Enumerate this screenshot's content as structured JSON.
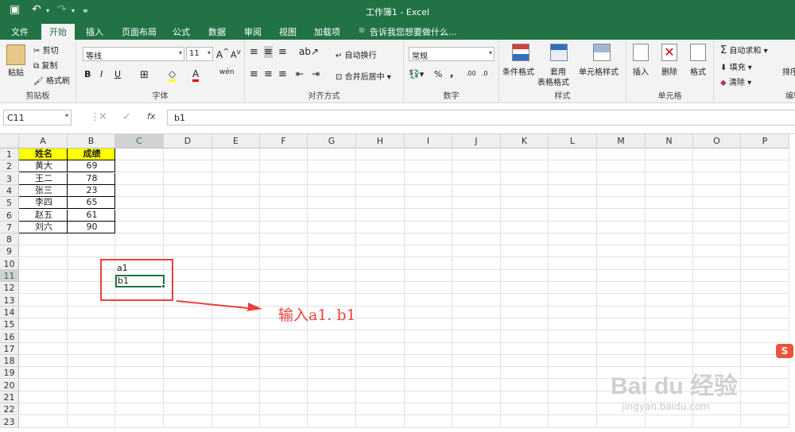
{
  "titlebar": {
    "title": "工作簿1 - Excel",
    "qa_save": "💾",
    "qa_undo": "↶",
    "qa_redo": "↷"
  },
  "tabs": [
    "文件",
    "开始",
    "插入",
    "页面布局",
    "公式",
    "数据",
    "审阅",
    "视图",
    "加载项"
  ],
  "tellme": "告诉我您想要做什么...",
  "ribbon": {
    "clipboard": {
      "paste": "粘贴",
      "cut": "剪切",
      "copy": "复制",
      "format_painter": "格式刷",
      "label": "剪贴板"
    },
    "font": {
      "name": "等线",
      "size": "11",
      "bold": "B",
      "italic": "I",
      "underline": "U",
      "label": "字体"
    },
    "align": {
      "wrap": "自动换行",
      "merge": "合并后居中",
      "label": "对齐方式"
    },
    "number": {
      "format": "常规",
      "percent": "%",
      "comma": ",",
      "label": "数字"
    },
    "styles": {
      "cond": "条件格式",
      "table": "套用",
      "table2": "表格格式",
      "cell": "单元格样式",
      "label": "样式"
    },
    "cells": {
      "insert": "插入",
      "delete": "删除",
      "format": "格式",
      "label": "单元格"
    },
    "edit": {
      "autosum": "自动求和",
      "fill": "填充",
      "clear": "清除",
      "sort": "排序",
      "label": "编辑"
    }
  },
  "formula": {
    "namebox": "C11",
    "fx": "fx",
    "value": "b1"
  },
  "columns": [
    "A",
    "B",
    "C",
    "D",
    "E",
    "F",
    "G",
    "H",
    "I",
    "J",
    "K",
    "L",
    "M",
    "N",
    "O",
    "P"
  ],
  "rows": [
    "1",
    "2",
    "3",
    "4",
    "5",
    "6",
    "7",
    "8",
    "9",
    "10",
    "11",
    "12",
    "13",
    "14",
    "15",
    "16",
    "17",
    "18",
    "19",
    "20",
    "21",
    "22",
    "23"
  ],
  "table": {
    "headers": [
      "姓名",
      "成绩"
    ],
    "data": [
      [
        "黄大",
        "69"
      ],
      [
        "王二",
        "78"
      ],
      [
        "张三",
        "23"
      ],
      [
        "李四",
        "65"
      ],
      [
        "赵五",
        "61"
      ],
      [
        "刘六",
        "90"
      ]
    ]
  },
  "cells": {
    "c10": "a1",
    "c11": "b1"
  },
  "annotation": {
    "text": "输入a1. b1",
    "color": "#e8413a"
  },
  "watermark": {
    "brand": "Bai du 经验",
    "url": "jingyan.baidu.com"
  }
}
